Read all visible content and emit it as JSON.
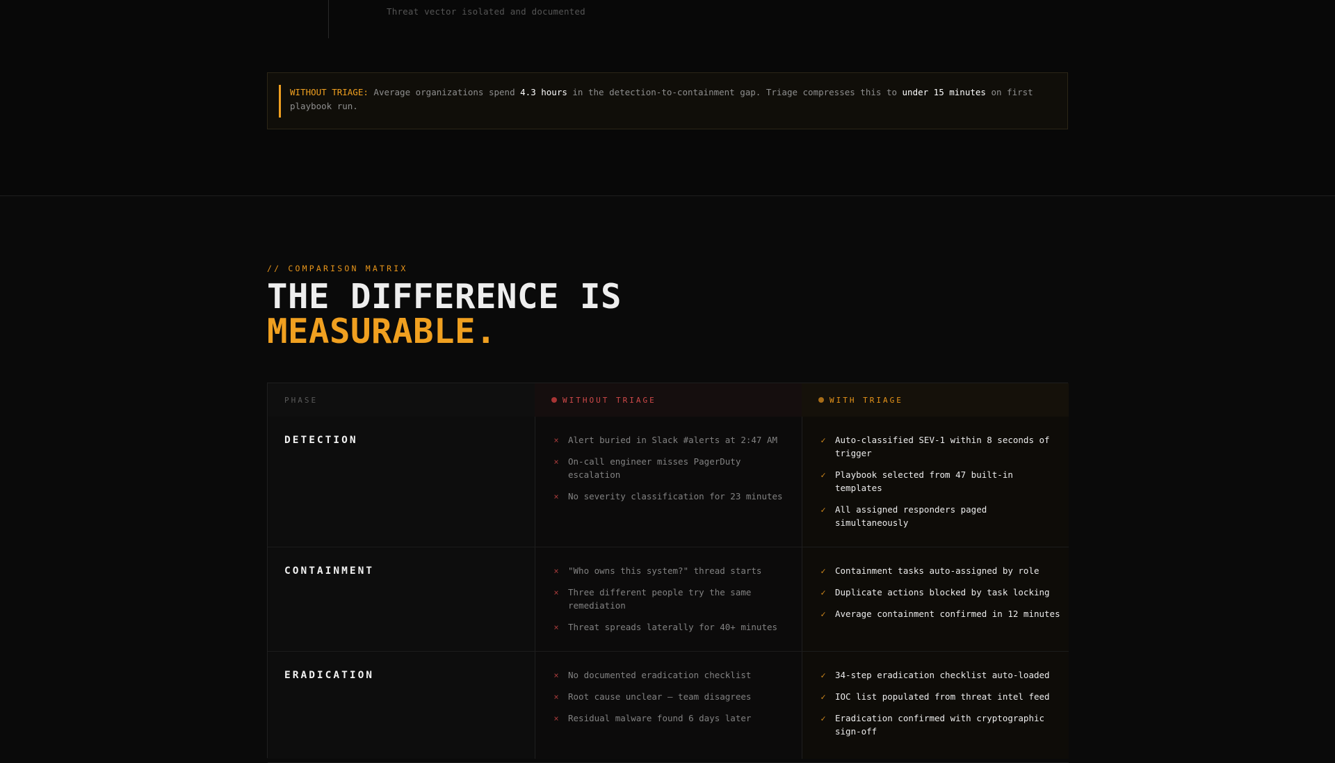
{
  "timeline": {
    "caption": "Threat vector isolated and documented"
  },
  "callout": {
    "label": "WITHOUT TRIAGE:",
    "text_1": " Average organizations spend ",
    "strong_1": "4.3 hours",
    "text_2": " in the detection-to-containment gap. Triage compresses this to ",
    "strong_2": "under 15 minutes",
    "text_3": " on first playbook run.",
    "accent_color": "#f0a020"
  },
  "section": {
    "eyebrow": "// COMPARISON MATRIX",
    "headline_line1": "THE DIFFERENCE IS",
    "headline_line2": "MEASURABLE."
  },
  "matrix": {
    "headers": {
      "phase": "PHASE",
      "without": "WITHOUT TRIAGE",
      "with": "WITH TRIAGE"
    },
    "rows": [
      {
        "phase": "DETECTION",
        "without": [
          "Alert buried in Slack #alerts at 2:47 AM",
          "On-call engineer misses PagerDuty escalation",
          "No severity classification for 23 minutes"
        ],
        "with": [
          "Auto-classified SEV-1 within 8 seconds of trigger",
          "Playbook selected from 47 built-in templates",
          "All assigned responders paged simultaneously"
        ]
      },
      {
        "phase": "CONTAINMENT",
        "without": [
          "\"Who owns this system?\" thread starts",
          "Three different people try the same remediation",
          "Threat spreads laterally for 40+ minutes"
        ],
        "with": [
          "Containment tasks auto-assigned by role",
          "Duplicate actions blocked by task locking",
          "Average containment confirmed in 12 minutes"
        ]
      },
      {
        "phase": "ERADICATION",
        "without": [
          "No documented eradication checklist",
          "Root cause unclear — team disagrees",
          "Residual malware found 6 days later"
        ],
        "with": [
          "34-step eradication checklist auto-loaded",
          "IOC list populated from threat intel feed",
          "Eradication confirmed with cryptographic sign-off"
        ]
      }
    ],
    "icons": {
      "without_mark": "×",
      "with_mark": "✓",
      "without_color": "#a33a3a",
      "with_color": "#d28a1c"
    }
  }
}
